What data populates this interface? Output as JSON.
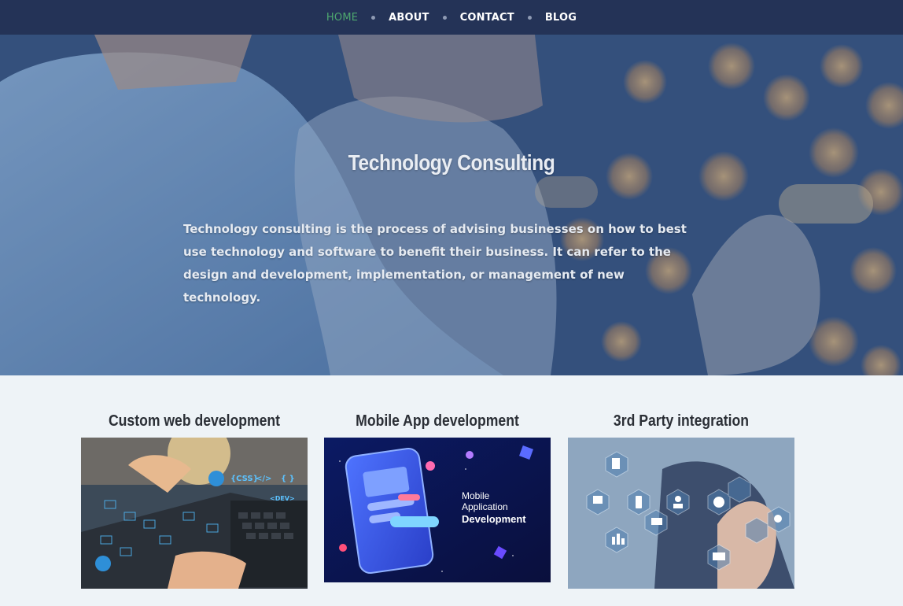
{
  "nav": {
    "items": [
      {
        "label": "HOME",
        "active": true
      },
      {
        "label": "ABOUT",
        "active": false
      },
      {
        "label": "CONTACT",
        "active": false
      },
      {
        "label": "BLOG",
        "active": false
      }
    ]
  },
  "hero": {
    "title": "Technology Consulting",
    "description": "Technology consulting is the process of advising businesses on how to best use technology and software to benefit their business. It can refer to the design and development, implementation, or management of new technology."
  },
  "services": [
    {
      "title": "Custom web development",
      "image_labels": [
        "{CSS}",
        "</>",
        "{ }",
        "<DEV>"
      ]
    },
    {
      "title": "Mobile App development",
      "image_labels": [
        "Mobile",
        "Application",
        "Development"
      ]
    },
    {
      "title": "3rd Party integration",
      "image_labels": []
    }
  ],
  "colors": {
    "nav_bg": "#243357",
    "nav_active": "#4ea86f",
    "page_bg": "#eef3f7"
  }
}
